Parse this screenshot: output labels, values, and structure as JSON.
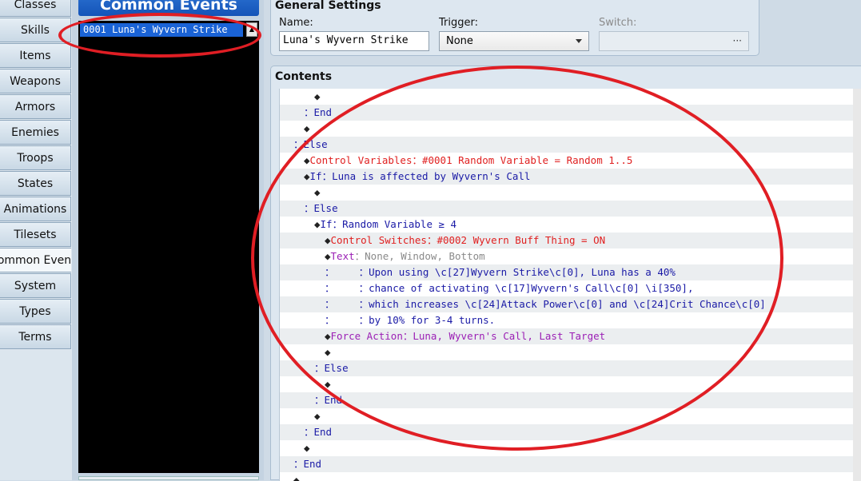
{
  "nav": {
    "tabs": [
      "Classes",
      "Skills",
      "Items",
      "Weapons",
      "Armors",
      "Enemies",
      "Troops",
      "States",
      "Animations",
      "Tilesets",
      "Common Events",
      "System",
      "Types",
      "Terms"
    ],
    "active": "Common Events"
  },
  "list": {
    "title": "Common Events",
    "items": [
      "0001 Luna's Wyvern Strike"
    ]
  },
  "general": {
    "title": "General Settings",
    "name_label": "Name:",
    "name_value": "Luna's Wyvern Strike",
    "trigger_label": "Trigger:",
    "trigger_value": "None",
    "switch_label": "Switch:",
    "switch_dots": "···"
  },
  "contents": {
    "title": "Contents",
    "lines": [
      {
        "indent": 3,
        "segs": [
          {
            "c": "dark",
            "t": "◆"
          }
        ]
      },
      {
        "indent": 2,
        "segs": [
          {
            "c": "blue",
            "t": "：End"
          }
        ]
      },
      {
        "indent": 2,
        "segs": [
          {
            "c": "dark",
            "t": "◆"
          }
        ]
      },
      {
        "indent": 1,
        "segs": [
          {
            "c": "blue",
            "t": "：Else"
          }
        ]
      },
      {
        "indent": 2,
        "segs": [
          {
            "c": "dark",
            "t": "◆"
          },
          {
            "c": "red",
            "t": "Control Variables：#0001 Random Variable = Random 1..5"
          }
        ]
      },
      {
        "indent": 2,
        "segs": [
          {
            "c": "dark",
            "t": "◆"
          },
          {
            "c": "blue",
            "t": "If：Luna is affected by Wyvern's Call"
          }
        ]
      },
      {
        "indent": 3,
        "segs": [
          {
            "c": "dark",
            "t": "◆"
          }
        ]
      },
      {
        "indent": 2,
        "segs": [
          {
            "c": "blue",
            "t": "：Else"
          }
        ]
      },
      {
        "indent": 3,
        "segs": [
          {
            "c": "dark",
            "t": "◆"
          },
          {
            "c": "blue",
            "t": "If：Random Variable ≥ 4"
          }
        ]
      },
      {
        "indent": 4,
        "segs": [
          {
            "c": "dark",
            "t": "◆"
          },
          {
            "c": "red",
            "t": "Control Switches：#0002 Wyvern Buff Thing = ON"
          }
        ]
      },
      {
        "indent": 4,
        "segs": [
          {
            "c": "dark",
            "t": "◆"
          },
          {
            "c": "purple",
            "t": "Text"
          },
          {
            "c": "gray",
            "t": "：None, Window, Bottom"
          }
        ]
      },
      {
        "indent": 4,
        "segs": [
          {
            "c": "blue",
            "t": "：    ：Upon using \\c[27]Wyvern Strike\\c[0], Luna has a 40%"
          }
        ]
      },
      {
        "indent": 4,
        "segs": [
          {
            "c": "blue",
            "t": "：    ：chance of activating \\c[17]Wyvern's Call\\c[0] \\i[350],"
          }
        ]
      },
      {
        "indent": 4,
        "segs": [
          {
            "c": "blue",
            "t": "：    ：which increases \\c[24]Attack Power\\c[0] and \\c[24]Crit Chance\\c[0]"
          }
        ]
      },
      {
        "indent": 4,
        "segs": [
          {
            "c": "blue",
            "t": "：    ：by 10% for 3-4 turns."
          }
        ]
      },
      {
        "indent": 4,
        "segs": [
          {
            "c": "dark",
            "t": "◆"
          },
          {
            "c": "purple",
            "t": "Force Action：Luna, Wyvern's Call, Last Target"
          }
        ]
      },
      {
        "indent": 4,
        "segs": [
          {
            "c": "dark",
            "t": "◆"
          }
        ]
      },
      {
        "indent": 3,
        "segs": [
          {
            "c": "blue",
            "t": "：Else"
          }
        ]
      },
      {
        "indent": 4,
        "segs": [
          {
            "c": "dark",
            "t": "◆"
          }
        ]
      },
      {
        "indent": 3,
        "segs": [
          {
            "c": "blue",
            "t": "：End"
          }
        ]
      },
      {
        "indent": 3,
        "segs": [
          {
            "c": "dark",
            "t": "◆"
          }
        ]
      },
      {
        "indent": 2,
        "segs": [
          {
            "c": "blue",
            "t": "：End"
          }
        ]
      },
      {
        "indent": 2,
        "segs": [
          {
            "c": "dark",
            "t": "◆"
          }
        ]
      },
      {
        "indent": 1,
        "segs": [
          {
            "c": "blue",
            "t": "：End"
          }
        ]
      },
      {
        "indent": 1,
        "segs": [
          {
            "c": "dark",
            "t": "◆"
          }
        ]
      }
    ]
  },
  "colors": {
    "accent": "#1a63d6",
    "annotation": "#e01e24",
    "command_red": "#e02020",
    "command_blue": "#1a1aa6",
    "command_purple": "#9b1fb5"
  }
}
